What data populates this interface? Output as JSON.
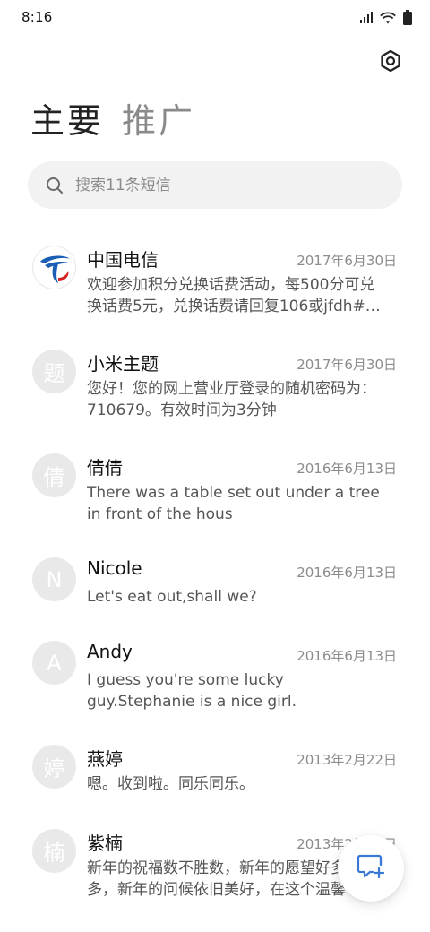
{
  "status_bar": {
    "time": "8:16",
    "icons": [
      "signal-icon",
      "wifi-icon",
      "battery-icon"
    ]
  },
  "header": {
    "settings_icon": "settings-icon"
  },
  "tabs": [
    {
      "label": "主要",
      "active": true
    },
    {
      "label": "推广",
      "active": false
    }
  ],
  "search": {
    "placeholder": "搜索11条短信",
    "value": ""
  },
  "conversations": [
    {
      "avatar": "",
      "avatar_icon": "china-telecom-logo",
      "name": "中国电信",
      "date": "2017年6月30日",
      "preview": "欢迎参加积分兑换话费活动，每500分可兑换话费5元，兑换话费请回复106或jfdh#…"
    },
    {
      "avatar": "题",
      "name": "小米主题",
      "date": "2017年6月30日",
      "preview": "您好！您的网上营业厅登录的随机密码为：710679。有效时间为3分钟"
    },
    {
      "avatar": "倩",
      "name": "倩倩",
      "date": "2016年6月13日",
      "preview": "There was a table set out under a tree in front of the hous"
    },
    {
      "avatar": "N",
      "name": "Nicole",
      "date": "2016年6月13日",
      "preview": "Let's eat out,shall we?"
    },
    {
      "avatar": "A",
      "name": "Andy",
      "date": "2016年6月13日",
      "preview": "I guess you're some lucky guy.Stephanie is a nice girl."
    },
    {
      "avatar": "婷",
      "name": "燕婷",
      "date": "2013年2月22日",
      "preview": "嗯。收到啦。同乐同乐。"
    },
    {
      "avatar": "楠",
      "name": "紫楠",
      "date": "2013年2月22日",
      "preview": "新年的祝福数不胜数，新年的愿望好多好多，新年的问候依旧美好，在这个温馨"
    }
  ],
  "fab": {
    "icon": "new-message-icon"
  },
  "colors": {
    "accent": "#3a78d6",
    "avatar_bg": "#e9e9e9",
    "search_bg": "#f2f2f2",
    "secondary_text": "#8c8c8c"
  }
}
